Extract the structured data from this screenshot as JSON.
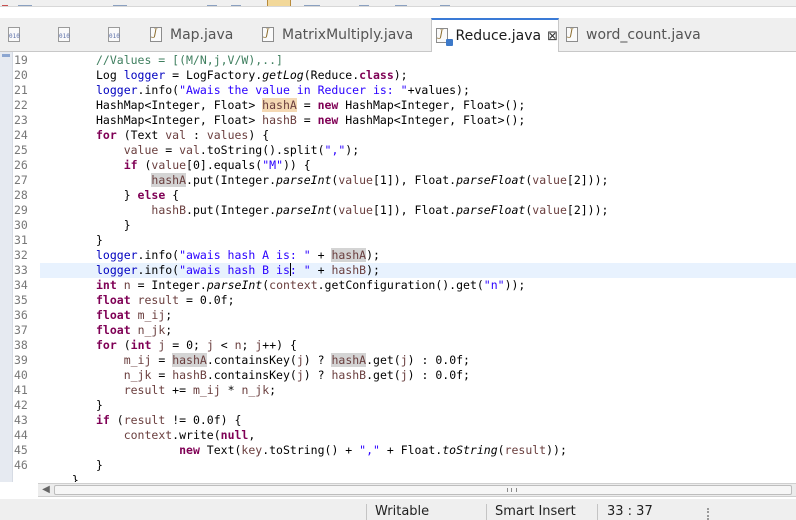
{
  "tabs": [
    {
      "label": "",
      "icon": "class-file-icon",
      "active": false
    },
    {
      "label": "",
      "icon": "class-file-icon",
      "active": false
    },
    {
      "label": "",
      "icon": "class-file-icon",
      "active": false
    },
    {
      "label": "Map.java",
      "icon": "java-file-icon",
      "active": false
    },
    {
      "label": "MatrixMultiply.java",
      "icon": "java-file-icon",
      "active": false
    },
    {
      "label": "Reduce.java",
      "icon": "java-file-icon",
      "active": true
    },
    {
      "label": "word_count.java",
      "icon": "java-file-icon",
      "active": false
    }
  ],
  "active_tab_close_glyph": "⊠",
  "editor": {
    "current_line": 33,
    "lines": [
      {
        "n": "19"
      },
      {
        "n": "20"
      },
      {
        "n": "21"
      },
      {
        "n": "22"
      },
      {
        "n": "23"
      },
      {
        "n": "24"
      },
      {
        "n": "25"
      },
      {
        "n": "26"
      },
      {
        "n": "27"
      },
      {
        "n": "28"
      },
      {
        "n": "29"
      },
      {
        "n": "30"
      },
      {
        "n": "31"
      },
      {
        "n": "32"
      },
      {
        "n": "33"
      },
      {
        "n": "34"
      },
      {
        "n": "35"
      },
      {
        "n": "36"
      },
      {
        "n": "37"
      },
      {
        "n": "38"
      },
      {
        "n": "39"
      },
      {
        "n": "40"
      },
      {
        "n": "41"
      },
      {
        "n": "42"
      },
      {
        "n": "43"
      },
      {
        "n": "44"
      },
      {
        "n": "45"
      },
      {
        "n": "46"
      }
    ],
    "code": [
      [
        [
          "cm",
          "//Values = [(M/N,j,V/W),..]"
        ]
      ],
      [
        [
          "",
          "Log "
        ],
        [
          "fld",
          "logger"
        ],
        [
          "",
          " = LogFactory."
        ],
        [
          "it",
          "getLog"
        ],
        [
          "",
          "(Reduce."
        ],
        [
          "kw",
          "class"
        ],
        [
          "",
          ");"
        ]
      ],
      [
        [
          "fld",
          "logger"
        ],
        [
          "",
          ".info("
        ],
        [
          "str",
          "\"Awais the value in Reducer is: \""
        ],
        [
          "",
          "+values);"
        ]
      ],
      [
        [
          "",
          "HashMap<Integer, Float> "
        ],
        [
          "var occw",
          "hashA"
        ],
        [
          "",
          " = "
        ],
        [
          "kw",
          "new"
        ],
        [
          "",
          " HashMap<Integer, Float>();"
        ]
      ],
      [
        [
          "",
          "HashMap<Integer, Float> "
        ],
        [
          "var",
          "hashB"
        ],
        [
          "",
          " = "
        ],
        [
          "kw",
          "new"
        ],
        [
          "",
          " HashMap<Integer, Float>();"
        ]
      ],
      [
        [
          "kw",
          "for"
        ],
        [
          "",
          " (Text "
        ],
        [
          "var",
          "val"
        ],
        [
          "",
          " : "
        ],
        [
          "var",
          "values"
        ],
        [
          "",
          ") {"
        ]
      ],
      [
        [
          "",
          "    "
        ],
        [
          "var",
          "value"
        ],
        [
          "",
          " = "
        ],
        [
          "var",
          "val"
        ],
        [
          "",
          ".toString().split("
        ],
        [
          "str",
          "\",\""
        ],
        [
          "",
          ");"
        ]
      ],
      [
        [
          "",
          "    "
        ],
        [
          "kw",
          "if"
        ],
        [
          "",
          " ("
        ],
        [
          "var",
          "value"
        ],
        [
          "",
          "[0].equals("
        ],
        [
          "str",
          "\"M\""
        ],
        [
          "",
          ")) {"
        ]
      ],
      [
        [
          "",
          "        "
        ],
        [
          "var occ",
          "hashA"
        ],
        [
          "",
          ".put(Integer."
        ],
        [
          "it",
          "parseInt"
        ],
        [
          "",
          "("
        ],
        [
          "var",
          "value"
        ],
        [
          "",
          "[1]), Float."
        ],
        [
          "it",
          "parseFloat"
        ],
        [
          "",
          "("
        ],
        [
          "var",
          "value"
        ],
        [
          "",
          "[2]));"
        ]
      ],
      [
        [
          "",
          "    } "
        ],
        [
          "kw",
          "else"
        ],
        [
          "",
          " {"
        ]
      ],
      [
        [
          "",
          "        "
        ],
        [
          "var",
          "hashB"
        ],
        [
          "",
          ".put(Integer."
        ],
        [
          "it",
          "parseInt"
        ],
        [
          "",
          "("
        ],
        [
          "var",
          "value"
        ],
        [
          "",
          "[1]), Float."
        ],
        [
          "it",
          "parseFloat"
        ],
        [
          "",
          "("
        ],
        [
          "var",
          "value"
        ],
        [
          "",
          "[2]));"
        ]
      ],
      [
        [
          "",
          "    }"
        ]
      ],
      [
        [
          "",
          "}"
        ]
      ],
      [
        [
          "fld",
          "logger"
        ],
        [
          "",
          ".info("
        ],
        [
          "str",
          "\"awais hash A is: \""
        ],
        [
          "",
          " + "
        ],
        [
          "var occ",
          "hashA"
        ],
        [
          "",
          ");"
        ]
      ],
      [
        [
          "fld",
          "logger"
        ],
        [
          "",
          ".info("
        ],
        [
          "str",
          "\"awais hash B is"
        ],
        [
          "caret",
          ""
        ],
        [
          "str",
          ": \""
        ],
        [
          "",
          " + "
        ],
        [
          "var",
          "hashB"
        ],
        [
          "",
          ");"
        ]
      ],
      [
        [
          "kw",
          "int"
        ],
        [
          "",
          " "
        ],
        [
          "var",
          "n"
        ],
        [
          "",
          " = Integer."
        ],
        [
          "it",
          "parseInt"
        ],
        [
          "",
          "("
        ],
        [
          "var",
          "context"
        ],
        [
          "",
          ".getConfiguration().get("
        ],
        [
          "str",
          "\"n\""
        ],
        [
          "",
          "));"
        ]
      ],
      [
        [
          "kw",
          "float"
        ],
        [
          "",
          " "
        ],
        [
          "var",
          "result"
        ],
        [
          "",
          " = 0.0f;"
        ]
      ],
      [
        [
          "kw",
          "float"
        ],
        [
          "",
          " "
        ],
        [
          "var",
          "m_ij"
        ],
        [
          "",
          ";"
        ]
      ],
      [
        [
          "kw",
          "float"
        ],
        [
          "",
          " "
        ],
        [
          "var",
          "n_jk"
        ],
        [
          "",
          ";"
        ]
      ],
      [
        [
          "kw",
          "for"
        ],
        [
          "",
          " ("
        ],
        [
          "kw",
          "int"
        ],
        [
          "",
          " "
        ],
        [
          "var",
          "j"
        ],
        [
          "",
          " = 0; "
        ],
        [
          "var",
          "j"
        ],
        [
          "",
          " < "
        ],
        [
          "var",
          "n"
        ],
        [
          "",
          "; "
        ],
        [
          "var",
          "j"
        ],
        [
          "",
          "++) {"
        ]
      ],
      [
        [
          "",
          "    "
        ],
        [
          "var",
          "m_ij"
        ],
        [
          "",
          " = "
        ],
        [
          "var occ",
          "hashA"
        ],
        [
          "",
          ".containsKey("
        ],
        [
          "var",
          "j"
        ],
        [
          "",
          ") ? "
        ],
        [
          "var occ",
          "hashA"
        ],
        [
          "",
          ".get("
        ],
        [
          "var",
          "j"
        ],
        [
          "",
          ") : 0.0f;"
        ]
      ],
      [
        [
          "",
          "    "
        ],
        [
          "var",
          "n_jk"
        ],
        [
          "",
          " = "
        ],
        [
          "var",
          "hashB"
        ],
        [
          "",
          ".containsKey("
        ],
        [
          "var",
          "j"
        ],
        [
          "",
          ") ? "
        ],
        [
          "var",
          "hashB"
        ],
        [
          "",
          ".get("
        ],
        [
          "var",
          "j"
        ],
        [
          "",
          ") : 0.0f;"
        ]
      ],
      [
        [
          "",
          "    "
        ],
        [
          "var",
          "result"
        ],
        [
          "",
          " += "
        ],
        [
          "var",
          "m_ij"
        ],
        [
          "",
          " * "
        ],
        [
          "var",
          "n_jk"
        ],
        [
          "",
          ";"
        ]
      ],
      [
        [
          "",
          "}"
        ]
      ],
      [
        [
          "kw",
          "if"
        ],
        [
          "",
          " ("
        ],
        [
          "var",
          "result"
        ],
        [
          "",
          " != 0.0f) {"
        ]
      ],
      [
        [
          "",
          "    "
        ],
        [
          "var",
          "context"
        ],
        [
          "",
          ".write("
        ],
        [
          "kw",
          "null"
        ],
        [
          "",
          ","
        ]
      ],
      [
        [
          "",
          "            "
        ],
        [
          "kw",
          "new"
        ],
        [
          "",
          " Text("
        ],
        [
          "var",
          "key"
        ],
        [
          "",
          ".toString() + "
        ],
        [
          "str",
          "\",\""
        ],
        [
          "",
          " + Float."
        ],
        [
          "it",
          "toString"
        ],
        [
          "",
          "("
        ],
        [
          "var",
          "result"
        ],
        [
          "",
          "));"
        ]
      ],
      [
        [
          "",
          "}"
        ]
      ]
    ],
    "partial_next_line": "  }"
  },
  "statusbar": {
    "mode": "Writable",
    "insert_mode": "Smart Insert",
    "position": "33 : 37"
  },
  "colors": {
    "keyword": "#7f0055",
    "string": "#2a00ff",
    "comment": "#3f7f5f",
    "field": "#0000c0",
    "local_variable": "#6a3e3e",
    "current_line": "#e8f2fe",
    "active_tab_accent": "#3a7ad6"
  }
}
